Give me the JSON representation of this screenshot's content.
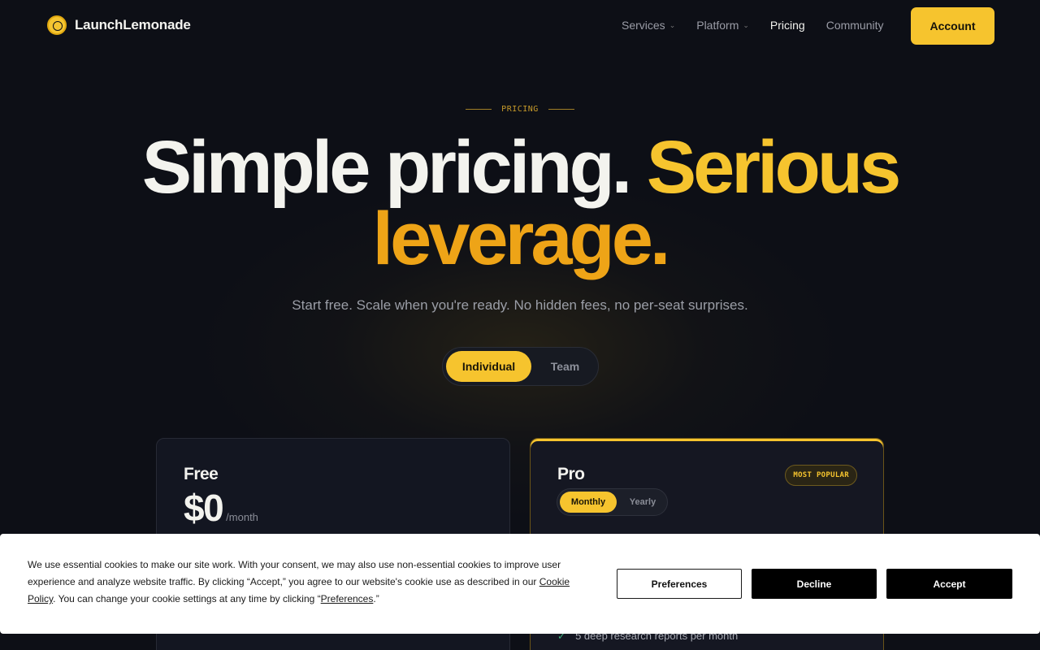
{
  "nav": {
    "brand": "LaunchLemonade",
    "links": [
      {
        "label": "Services",
        "has_menu": true
      },
      {
        "label": "Platform",
        "has_menu": true
      },
      {
        "label": "Pricing",
        "active": true
      },
      {
        "label": "Community"
      }
    ],
    "account_label": "Account"
  },
  "hero": {
    "eyebrow": "PRICING",
    "headline_part1": "Simple pricing. ",
    "headline_part2": "Serious",
    "headline_part3": "leverage.",
    "subtitle": "Start free. Scale when you're ready. No hidden fees, no per-seat surprises.",
    "plan_toggle": {
      "selected": "Individual",
      "options": [
        "Individual",
        "Team"
      ]
    }
  },
  "plans": {
    "free": {
      "name": "Free",
      "price": "$0",
      "period": "/month"
    },
    "pro": {
      "name": "Pro",
      "badge": "MOST POPULAR",
      "billing": {
        "selected": "Monthly",
        "options": [
          "Monthly",
          "Yearly"
        ]
      },
      "feature_visible": "5 deep research reports per month"
    }
  },
  "cookie": {
    "text_before_link1": "We use essential cookies to make our site work. With your consent, we may also use non-essential cookies to improve user experience and analyze website traffic. By clicking “Accept,” you agree to our website's cookie use as described in our ",
    "link1": "Cookie Policy",
    "text_middle": ". You can change your cookie settings at any time by clicking “",
    "link2": "Preferences",
    "text_end": ".”",
    "preferences_label": "Preferences",
    "decline_label": "Decline",
    "accept_label": "Accept"
  },
  "colors": {
    "accent": "#f6c42e",
    "accent_deep": "#eea417",
    "background": "#0d0f16",
    "check": "#3fb27f"
  }
}
